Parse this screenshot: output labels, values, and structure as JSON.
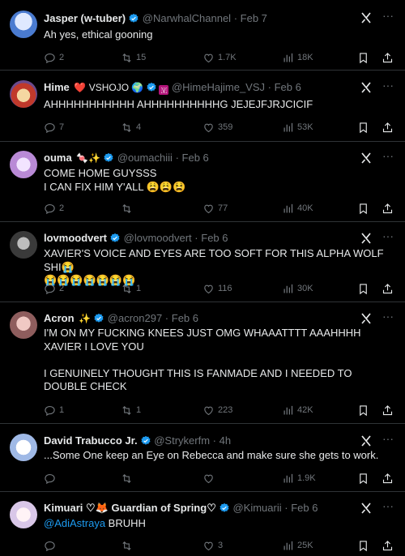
{
  "tweets": [
    {
      "name": "Jasper (w-tuber)",
      "emoji": "",
      "handle": "@NarwhalChannel",
      "time": "Feb 7",
      "text": "Ah yes, ethical gooning",
      "replies": "2",
      "retweets": "15",
      "likes": "1.7K",
      "views": "18K",
      "avatar_colors": [
        "#4a7bd0",
        "#dfe9ff"
      ]
    },
    {
      "name": "Hime",
      "emoji": "❤️ VSHOJO 🌍",
      "emoji2": "🇻",
      "handle": "@HimeHajime_VSJ",
      "time": "Feb 6",
      "text": "AHHHHHHHHHHH AHHHHHHHHHHG JEJEJFJRJCICIF",
      "replies": "7",
      "retweets": "4",
      "likes": "359",
      "views": "53K",
      "avatar_colors": [
        "#c0392b",
        "#f5d7a1"
      ]
    },
    {
      "name": "ouma",
      "emoji": "🍬✨",
      "handle": "@oumachiii",
      "time": "Feb 6",
      "text": "COME HOME GUYSSS\nI CAN FIX HIM Y'ALL 😩😩😫",
      "replies": "2",
      "retweets": "",
      "likes": "77",
      "views": "40K",
      "avatar_colors": [
        "#b98ad6",
        "#f2e4ff"
      ]
    },
    {
      "name": "lovmoodvert",
      "emoji": "",
      "handle": "@lovmoodvert",
      "time": "Feb 6",
      "text": "XAVIER'S VOICE AND EYES ARE TOO SOFT FOR THIS ALPHA WOLF SHI😭\n😭😭😭😭😭😭😭",
      "replies": "2",
      "retweets": "1",
      "likes": "116",
      "views": "30K",
      "avatar_colors": [
        "#3a3a3a",
        "#bdbdbd"
      ]
    },
    {
      "name": "Acron",
      "emoji": "✨",
      "handle": "@acron297",
      "time": "Feb 6",
      "text": "I'M ON MY FUCKING KNEES JUST OMG WHAAATTTT AAAHHHH XAVIER I LOVE YOU\n\nI GENUINELY THOUGHT THIS IS FANMADE AND I NEEDED TO DOUBLE CHECK",
      "replies": "1",
      "retweets": "1",
      "likes": "223",
      "views": "42K",
      "avatar_colors": [
        "#8e5d5d",
        "#f0c9c4"
      ]
    },
    {
      "name": "David Trabucco Jr.",
      "emoji": "",
      "handle": "@Strykerfm",
      "time": "4h",
      "text": "...Some One keep an Eye on Rebecca and make sure she gets to work.",
      "replies": "",
      "retweets": "",
      "likes": "",
      "views": "1.9K",
      "avatar_colors": [
        "#9fb9e6",
        "#ffffff"
      ]
    },
    {
      "name": "Kimuari ♡🦊 Guardian of Spring♡",
      "emoji": "",
      "handle": "@Kimuarii",
      "time": "Feb 6",
      "mention": "@AdiAstraya",
      "text": " BRUHH",
      "replies": "",
      "retweets": "",
      "likes": "3",
      "views": "25K",
      "avatar_colors": [
        "#d9c7e8",
        "#fff3f6"
      ]
    }
  ],
  "colors": {
    "verified": "#1d9bf0",
    "text": "#e7e9ea",
    "muted": "#71767b",
    "border": "#2f3336",
    "background": "#000000"
  },
  "icons": {
    "reply": "reply-icon",
    "retweet": "retweet-icon",
    "like": "heart-icon",
    "views": "views-icon",
    "bookmark": "bookmark-icon",
    "share": "share-icon",
    "grok": "grok-icon",
    "more": "more-icon",
    "verified": "verified-badge-icon"
  }
}
